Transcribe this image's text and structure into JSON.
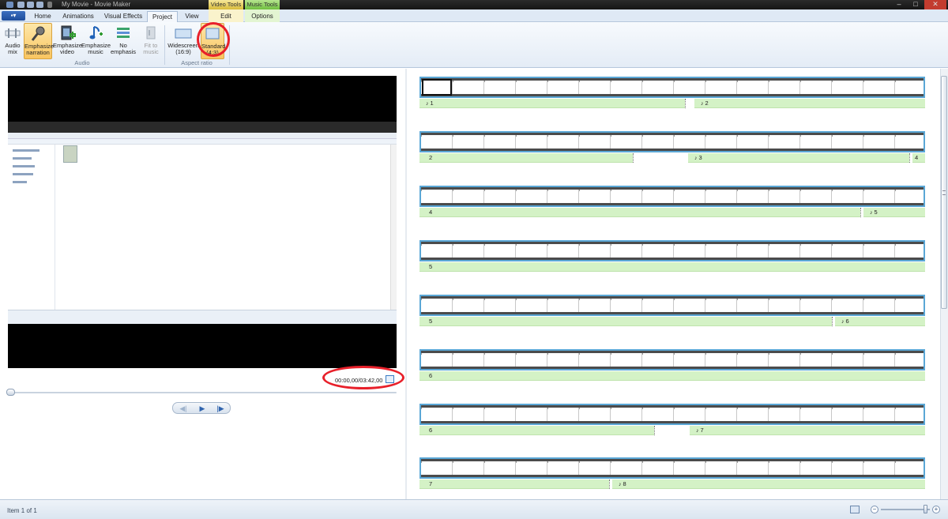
{
  "window": {
    "title": "My Movie - Movie Maker",
    "contextual_tabs": [
      "Video Tools",
      "Music Tools"
    ],
    "controls": {
      "minimize": "–",
      "maximize": "□",
      "close": "✕"
    }
  },
  "tabs": [
    {
      "label": "Home"
    },
    {
      "label": "Animations"
    },
    {
      "label": "Visual Effects"
    },
    {
      "label": "Project",
      "active": true
    },
    {
      "label": "View"
    },
    {
      "label": "Edit"
    },
    {
      "label": "Options"
    }
  ],
  "app_menu_label": "▪▾",
  "ribbon": {
    "audio_group": {
      "label": "Audio",
      "buttons": [
        {
          "label": "Audio mix",
          "icon": "audio-mix-icon"
        },
        {
          "label": "Emphasize narration",
          "icon": "microphone-icon",
          "selected": true
        },
        {
          "label": "Emphasize video",
          "icon": "video-emphasis-icon"
        },
        {
          "label": "Emphasize music",
          "icon": "music-note-icon"
        },
        {
          "label": "No emphasis",
          "icon": "no-emphasis-icon"
        },
        {
          "label": "Fit to music",
          "icon": "fit-to-music-icon",
          "disabled": true
        }
      ]
    },
    "aspect_group": {
      "label": "Aspect ratio",
      "buttons": [
        {
          "label": "Widescreen (16:9)",
          "icon": "widescreen-icon"
        },
        {
          "label": "Standard (4:3)",
          "icon": "standard-icon",
          "selected": true
        }
      ]
    }
  },
  "preview": {
    "timecode": "00:00,00/03:42,00",
    "seek_position": 0,
    "controls": {
      "prev": "◀|",
      "play": "▶",
      "next": "|▶"
    }
  },
  "storyboard": {
    "rows": [
      {
        "video": "",
        "music": [
          {
            "label": "1",
            "note": true
          },
          {
            "label": "2",
            "note": true
          }
        ]
      },
      {
        "video": "2",
        "music": [
          {
            "label": "3",
            "note": true
          },
          {
            "label": "4",
            "note": false
          }
        ]
      },
      {
        "video": "4",
        "music": [
          {
            "label": "5",
            "note": true
          }
        ]
      },
      {
        "video": "5",
        "music": []
      },
      {
        "video": "5",
        "music": [
          {
            "label": "6",
            "note": true
          }
        ]
      },
      {
        "video": "6",
        "music": []
      },
      {
        "video": "6",
        "music": [
          {
            "label": "7",
            "note": true
          }
        ]
      },
      {
        "video": "7",
        "music": [
          {
            "label": "8",
            "note": true
          }
        ]
      }
    ]
  },
  "status": {
    "text": "Item 1 of 1",
    "zoom_in": "+",
    "zoom_out": "−",
    "zoom_level": 0.9
  }
}
